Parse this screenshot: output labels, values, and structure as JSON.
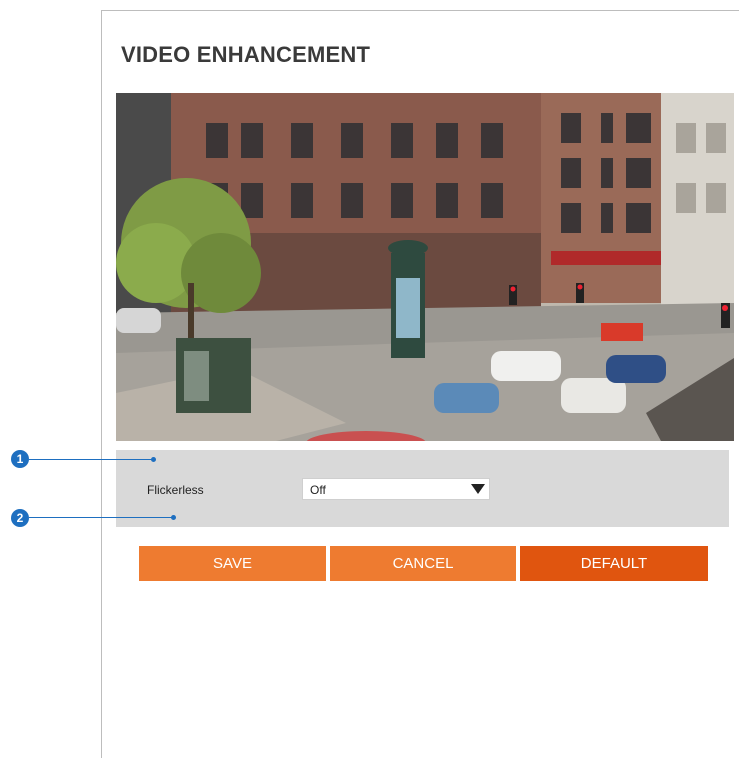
{
  "page": {
    "title": "VIDEO ENHANCEMENT"
  },
  "video": {
    "description_icon": "camera-live-view"
  },
  "settings": {
    "flickerless_label": "Flickerless",
    "flickerless_value": "Off",
    "flickerless_options": [
      "Off"
    ]
  },
  "callouts": [
    "1",
    "2"
  ],
  "buttons": {
    "save": "SAVE",
    "cancel": "CANCEL",
    "default": "DEFAULT"
  },
  "colors": {
    "button": "#ee7b30",
    "button_default": "#e0550f",
    "callout": "#1e6fc0",
    "panel": "#d9d9d9"
  }
}
